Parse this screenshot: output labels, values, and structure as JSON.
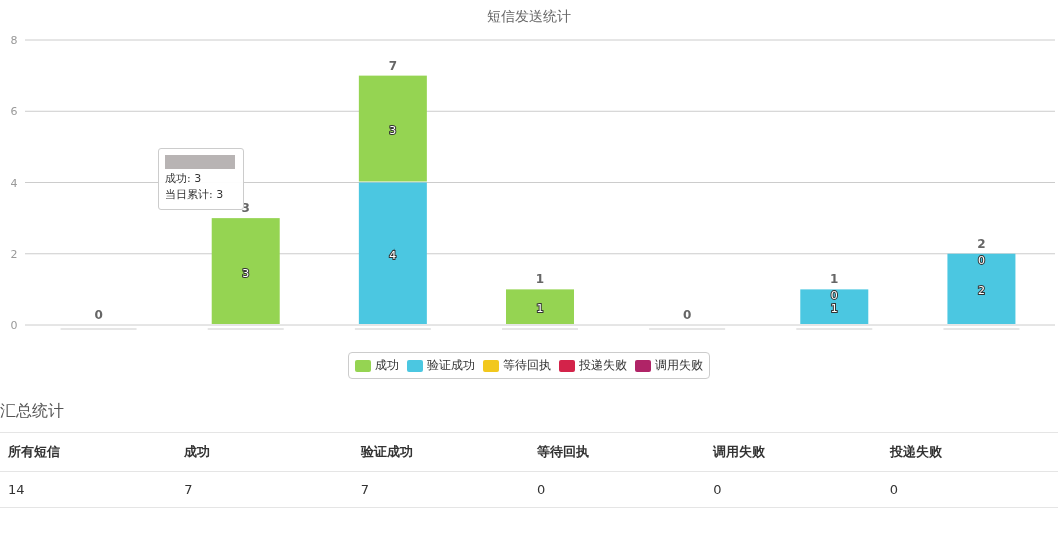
{
  "chart": {
    "chart_data": {
      "type": "bar",
      "title": "短信发送统计",
      "stacked": true,
      "ylim": [
        0,
        8
      ],
      "yticks": [
        0,
        2,
        4,
        6,
        8
      ],
      "grid": true,
      "legend": true,
      "series": [
        {
          "name": "成功",
          "color": "#95d452",
          "values": [
            0,
            3,
            3,
            1,
            0,
            0,
            0
          ],
          "value_labels": [
            null,
            "3",
            "3",
            "1",
            null,
            "0",
            "0"
          ]
        },
        {
          "name": "验证成功",
          "color": "#4bc7e1",
          "values": [
            0,
            0,
            4,
            0,
            0,
            1,
            2
          ],
          "value_labels": [
            null,
            null,
            "4",
            null,
            null,
            "1",
            "2"
          ]
        },
        {
          "name": "等待回执",
          "color": "#f2c81d",
          "values": [
            0,
            0,
            0,
            0,
            0,
            0,
            0
          ],
          "value_labels": [
            null,
            null,
            null,
            null,
            null,
            null,
            null
          ]
        },
        {
          "name": "投递失败",
          "color": "#d3234a",
          "values": [
            0,
            0,
            0,
            0,
            0,
            0,
            0
          ],
          "value_labels": [
            null,
            null,
            null,
            null,
            null,
            null,
            null
          ]
        },
        {
          "name": "调用失败",
          "color": "#b02467",
          "values": [
            0,
            0,
            0,
            0,
            0,
            0,
            0
          ],
          "value_labels": [
            null,
            null,
            null,
            null,
            null,
            null,
            null
          ]
        }
      ]
    },
    "total_labels": [
      "0",
      "3",
      "7",
      "1",
      "0",
      "1",
      "2"
    ],
    "tooltip": {
      "rows": [
        "成功: 3",
        "当日累计: 3"
      ]
    }
  },
  "summary": {
    "title": "汇总统计",
    "columns": [
      "所有短信",
      "成功",
      "验证成功",
      "等待回执",
      "调用失败",
      "投递失败"
    ],
    "rows": [
      [
        "14",
        "7",
        "7",
        "0",
        "0",
        "0"
      ]
    ]
  }
}
